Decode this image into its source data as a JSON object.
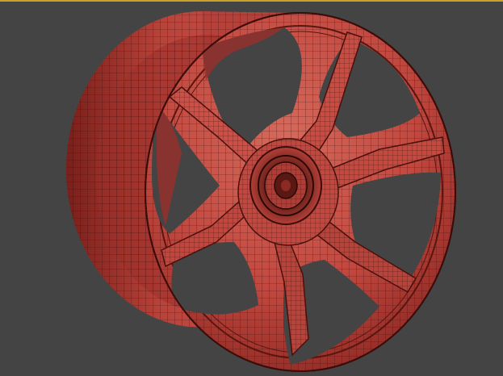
{
  "viewport": {
    "background_color": "#444444",
    "border_color": "#c9a227",
    "active": true
  },
  "model": {
    "object": "wheel-rim",
    "display_mode": "shaded-with-wireframe",
    "spoke_count": 6,
    "base_color": "#c2483f",
    "shadow_color": "#7a1f1a",
    "highlight_color": "#d96a5e",
    "wire_color": "#3a0c0a"
  }
}
